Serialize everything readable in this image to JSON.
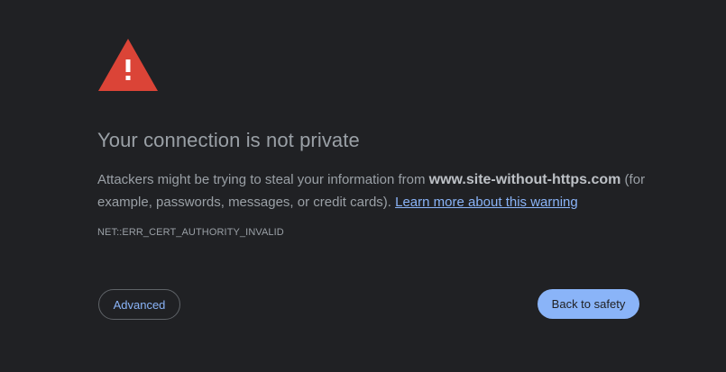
{
  "colors": {
    "background": "#202124",
    "warning_red": "#db4437",
    "text_secondary": "#9aa0a6",
    "link_blue": "#8ab4f8"
  },
  "icon": "warning-triangle-icon",
  "interstitial": {
    "title": "Your connection is not private",
    "body_prefix": "Attackers might be trying to steal your information from ",
    "domain": "www.site-without-https.com",
    "body_suffix": " (for example, passwords, messages, or credit cards). ",
    "learn_more_link": "Learn more about this warning",
    "error_code": "NET::ERR_CERT_AUTHORITY_INVALID"
  },
  "buttons": {
    "advanced": "Advanced",
    "back_to_safety": "Back to safety"
  }
}
